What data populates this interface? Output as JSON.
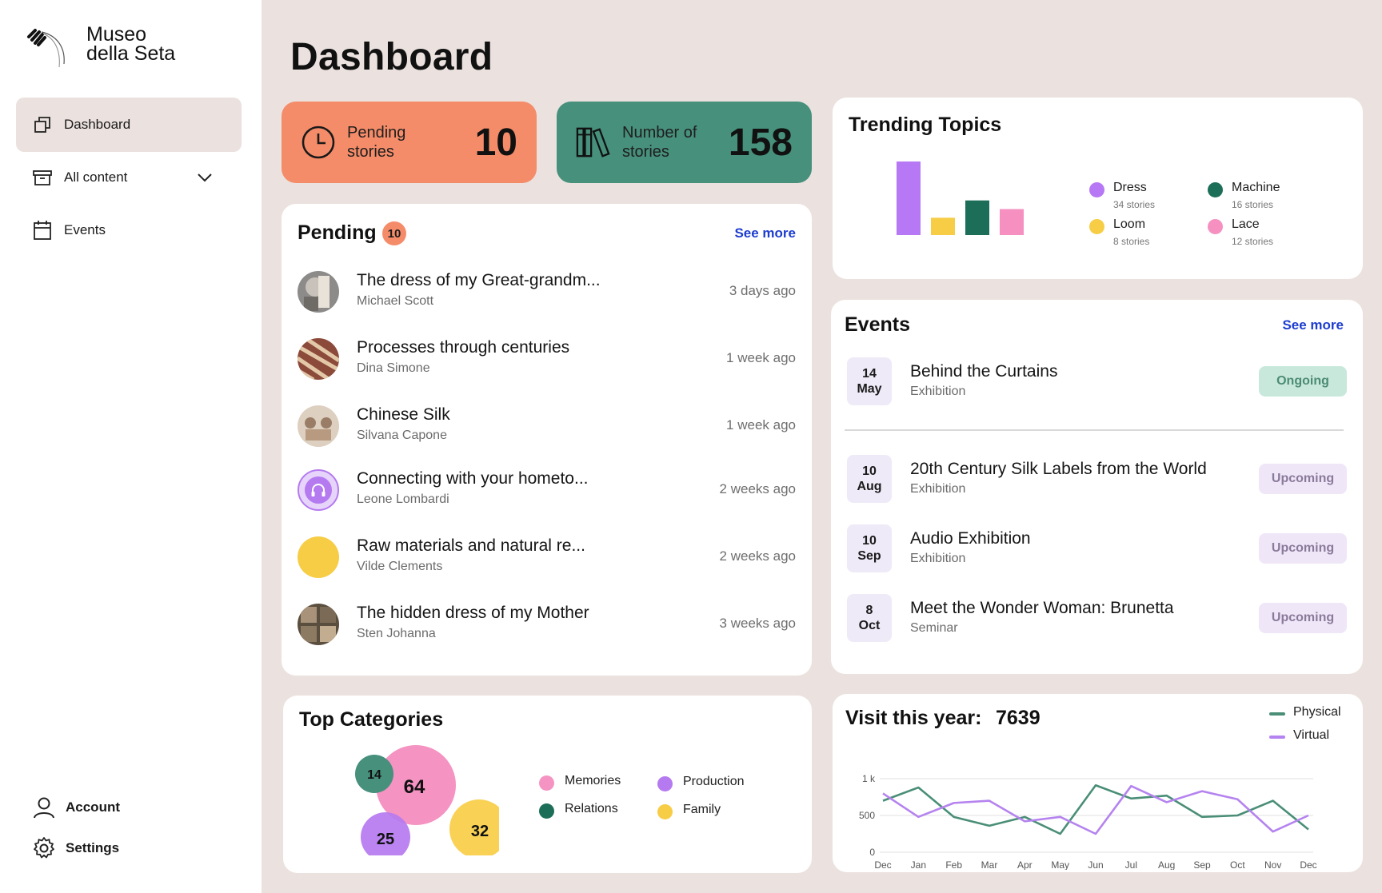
{
  "brand": {
    "line1": "Museo",
    "line2": "della Seta"
  },
  "nav": {
    "dashboard": "Dashboard",
    "all_content": "All content",
    "events": "Events",
    "account": "Account",
    "settings": "Settings"
  },
  "page": {
    "title": "Dashboard"
  },
  "stats": {
    "pending": {
      "label_1": "Pending",
      "label_2": "stories",
      "value": "10",
      "color": "#f58c69"
    },
    "number": {
      "label_1": "Number of",
      "label_2": "stories",
      "value": "158",
      "color": "#47907c"
    }
  },
  "pending": {
    "title": "Pending",
    "badge": "10",
    "see_more": "See more",
    "items": [
      {
        "title": "The dress of my Great-grandm...",
        "author": "Michael Scott",
        "time": "3 days ago",
        "avatar": "photo"
      },
      {
        "title": "Processes through centuries",
        "author": "Dina Simone",
        "time": "1 week ago",
        "avatar": "photo"
      },
      {
        "title": "Chinese Silk",
        "author": "Silvana Capone",
        "time": "1 week ago",
        "avatar": "photo"
      },
      {
        "title": "Connecting with your hometo...",
        "author": "Leone Lombardi",
        "time": "2 weeks ago",
        "avatar": "headphones-icon"
      },
      {
        "title": "Raw materials and natural re...",
        "author": "Vilde Clements",
        "time": "2 weeks ago",
        "avatar": "yellow-circle"
      },
      {
        "title": "The hidden dress of my Mother",
        "author": "Sten Johanna",
        "time": "3 weeks ago",
        "avatar": "photo"
      }
    ]
  },
  "trending": {
    "title": "Trending Topics",
    "topics": [
      {
        "name": "Dress",
        "count": "34 stories",
        "value": 34,
        "color": "#b678f4"
      },
      {
        "name": "Loom",
        "count": "8 stories",
        "value": 8,
        "color": "#f7cd46"
      },
      {
        "name": "Machine",
        "count": "16 stories",
        "value": 16,
        "color": "#1d6e58"
      },
      {
        "name": "Lace",
        "count": "12 stories",
        "value": 12,
        "color": "#f590c0"
      }
    ]
  },
  "events": {
    "title": "Events",
    "see_more": "See more",
    "items": [
      {
        "day": "14",
        "month": "May",
        "title": "Behind the Curtains",
        "type": "Exhibition",
        "status": "Ongoing"
      },
      {
        "day": "10",
        "month": "Aug",
        "title": "20th Century Silk Labels from the World",
        "type": "Exhibition",
        "status": "Upcoming"
      },
      {
        "day": "10",
        "month": "Sep",
        "title": "Audio Exhibition",
        "type": "Exhibition",
        "status": "Upcoming"
      },
      {
        "day": "8",
        "month": "Oct",
        "title": "Meet the Wonder Woman: Brunetta",
        "type": "Seminar",
        "status": "Upcoming"
      }
    ]
  },
  "categories": {
    "title": "Top Categories",
    "items": [
      {
        "name": "Memories",
        "value": "64",
        "color": "#f593c2"
      },
      {
        "name": "Production",
        "value": "25",
        "color": "#b57af0"
      },
      {
        "name": "Relations",
        "value": "14",
        "color": "#47907c"
      },
      {
        "name": "Family",
        "value": "32",
        "color": "#f7cd46"
      }
    ]
  },
  "visits": {
    "title": "Visit this year:",
    "total": "7639"
  },
  "chart_data": {
    "type": "line",
    "title": "Visit this year:",
    "x": [
      "Dec",
      "Jan",
      "Feb",
      "Mar",
      "Apr",
      "May",
      "Jun",
      "Jul",
      "Aug",
      "Sep",
      "Oct",
      "Nov",
      "Dec"
    ],
    "y_ticks": [
      "0",
      "500",
      "1 k"
    ],
    "ylim": [
      0,
      1000
    ],
    "grid": true,
    "legend": "top-right",
    "series": [
      {
        "name": "Physical",
        "color": "#4a8e77",
        "values": [
          700,
          880,
          480,
          360,
          480,
          250,
          910,
          730,
          770,
          480,
          500,
          700,
          310
        ]
      },
      {
        "name": "Virtual",
        "color": "#b583ef",
        "values": [
          800,
          480,
          670,
          700,
          420,
          480,
          250,
          900,
          680,
          830,
          720,
          280,
          500
        ]
      }
    ]
  }
}
